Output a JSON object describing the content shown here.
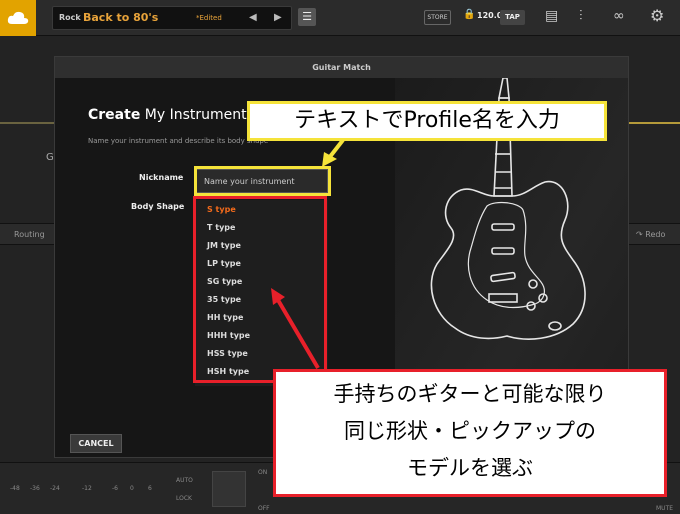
{
  "topbar": {
    "preset_category": "Rock",
    "preset_name": "Back to 80's",
    "preset_status": "*Edited",
    "prev_arrow": "◀",
    "next_arrow": "▶",
    "menu_icon": "☰",
    "store_label": "STORE",
    "tempo": "120.0",
    "tap_label": "TAP",
    "icons": [
      "cloud-logo-icon",
      "menu-icon",
      "lock-icon",
      "presets-icon",
      "tuner-icon",
      "loop-icon",
      "gear-icon"
    ]
  },
  "background": {
    "routing_label": "Routing",
    "redo_label": "Redo",
    "fragment_g": "G",
    "bottom": {
      "meter_labels": [
        "-48",
        "-36",
        "-24",
        "-12",
        "-6",
        "0",
        "6"
      ],
      "auto_label": "AUTO",
      "lock_label": "LOCK",
      "on_label": "ON",
      "off_label": "OFF",
      "mute_label": "MUTE"
    }
  },
  "modal": {
    "title": "Guitar Match",
    "heading_bold": "Create",
    "heading_rest": "My Instrument",
    "subtext": "Name your instrument and describe its body shape",
    "nickname_label": "Nickname",
    "nickname_placeholder": "Name your instrument",
    "body_shape_label": "Body Shape",
    "body_shapes": [
      "S type",
      "T type",
      "JM type",
      "LP type",
      "SG type",
      "35 type",
      "HH type",
      "HHH type",
      "HSS type",
      "HSH type"
    ],
    "selected_body_shape": "S type",
    "cancel_label": "CANCEL"
  },
  "annotations": {
    "nickname_callout": "テキストでProfile名を入力",
    "body_callout_line1": "手持ちのギターと可能な限り",
    "body_callout_line2": "同じ形状・ピックアップの",
    "body_callout_line3": "モデルを選ぶ",
    "colors": {
      "yellow": "#f5e33a",
      "red": "#e8202a",
      "accent_orange": "#f26a1b"
    }
  }
}
